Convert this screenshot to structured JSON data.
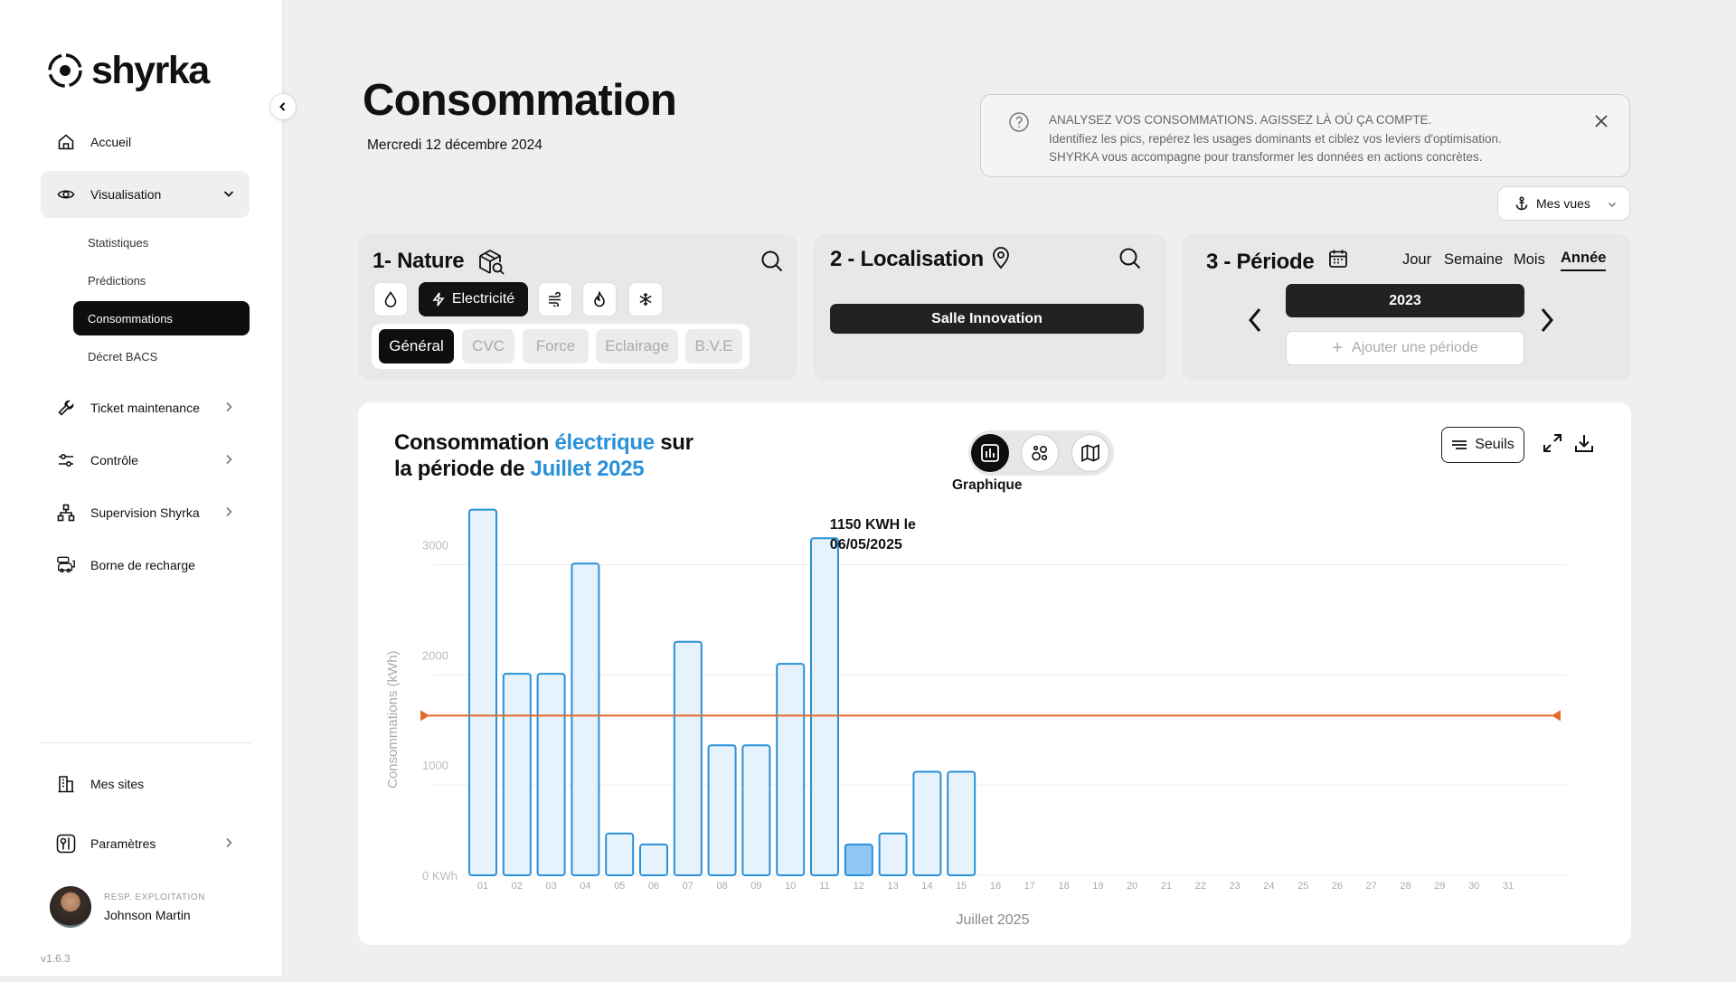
{
  "app": {
    "logo_text": "shyrka",
    "version": "v1.6.3"
  },
  "sidebar": {
    "items": [
      {
        "label": "Accueil",
        "icon": "home-icon"
      },
      {
        "label": "Visualisation",
        "icon": "eye-icon"
      },
      {
        "label": "Ticket maintenance",
        "icon": "wrench-icon"
      },
      {
        "label": "Contrôle",
        "icon": "sliders-icon"
      },
      {
        "label": "Supervision Shyrka",
        "icon": "network-icon"
      },
      {
        "label": "Borne de recharge",
        "icon": "ev-charger-icon"
      }
    ],
    "sub_items": [
      "Statistiques",
      "Prédictions",
      "Consommations",
      "Décret BACS"
    ],
    "bottom_items": [
      {
        "label": "Mes sites",
        "icon": "building-icon"
      },
      {
        "label": "Paramètres",
        "icon": "settings-icon"
      }
    ],
    "user": {
      "role": "RESP. EXPLOITATION",
      "name": "Johnson Martin"
    }
  },
  "header": {
    "title": "Consommation",
    "date": "Mercredi 12 décembre 2024"
  },
  "info": {
    "line1": "ANALYSEZ VOS CONSOMMATIONS. AGISSEZ LÀ OÙ ÇA COMPTE.",
    "line2": "Identifiez les pics, repérez les usages dominants et ciblez vos leviers d'optimisation.",
    "line3": "SHYRKA vous accompagne pour transformer les données en actions concrètes."
  },
  "views": {
    "label": "Mes vues"
  },
  "filters": {
    "nature": {
      "title": "1- Nature",
      "selected_label": "Electricité",
      "types": [
        "water-drop-icon",
        "lightning-icon",
        "wind-icon",
        "flame-icon",
        "snowflake-icon"
      ],
      "subtabs": [
        "Général",
        "CVC",
        "Force",
        "Eclairage",
        "B.V.E"
      ],
      "active_subtab": "Général"
    },
    "localisation": {
      "title": "2 - Localisation",
      "value": "Salle Innovation"
    },
    "periode": {
      "title": "3 - Période",
      "tabs": [
        "Jour",
        "Semaine",
        "Mois",
        "Année"
      ],
      "active_tab": "Année",
      "year": "2023",
      "add_label": "Ajouter une période"
    }
  },
  "chart_panel": {
    "title_part1": "Consommation ",
    "title_highlight1": "électrique",
    "title_part2": " sur",
    "title_part3": "la période de ",
    "title_highlight2": "Juillet 2025",
    "view_label": "Graphique",
    "seuils_label": "Seuils",
    "accent_color": "#2a91d8",
    "threshold_color": "#e46a2a"
  },
  "chart_data": {
    "type": "bar",
    "xlabel": "Juillet 2025",
    "ylabel": "Consommations (kWh)",
    "ytick_labels": [
      "0 KWh",
      "1000",
      "2000",
      "3000"
    ],
    "yticks": [
      0,
      1000,
      2000,
      3000
    ],
    "ylim": [
      0,
      3300
    ],
    "categories": [
      "01",
      "02",
      "03",
      "04",
      "05",
      "06",
      "07",
      "08",
      "09",
      "10",
      "11",
      "12",
      "13",
      "14",
      "15",
      "16",
      "17",
      "18",
      "19",
      "20",
      "21",
      "22",
      "23",
      "24",
      "25",
      "26",
      "27",
      "28",
      "29",
      "30",
      "31"
    ],
    "values": [
      3320,
      1830,
      1830,
      2830,
      380,
      280,
      2120,
      1180,
      1180,
      1920,
      3060,
      280,
      380,
      940,
      940,
      null,
      null,
      null,
      null,
      null,
      null,
      null,
      null,
      null,
      null,
      null,
      null,
      null,
      null,
      null
    ],
    "highlight_index": 11,
    "threshold": 1450,
    "tooltip": {
      "line1": "1150 KWH le",
      "line2": "06/05/2025"
    }
  }
}
